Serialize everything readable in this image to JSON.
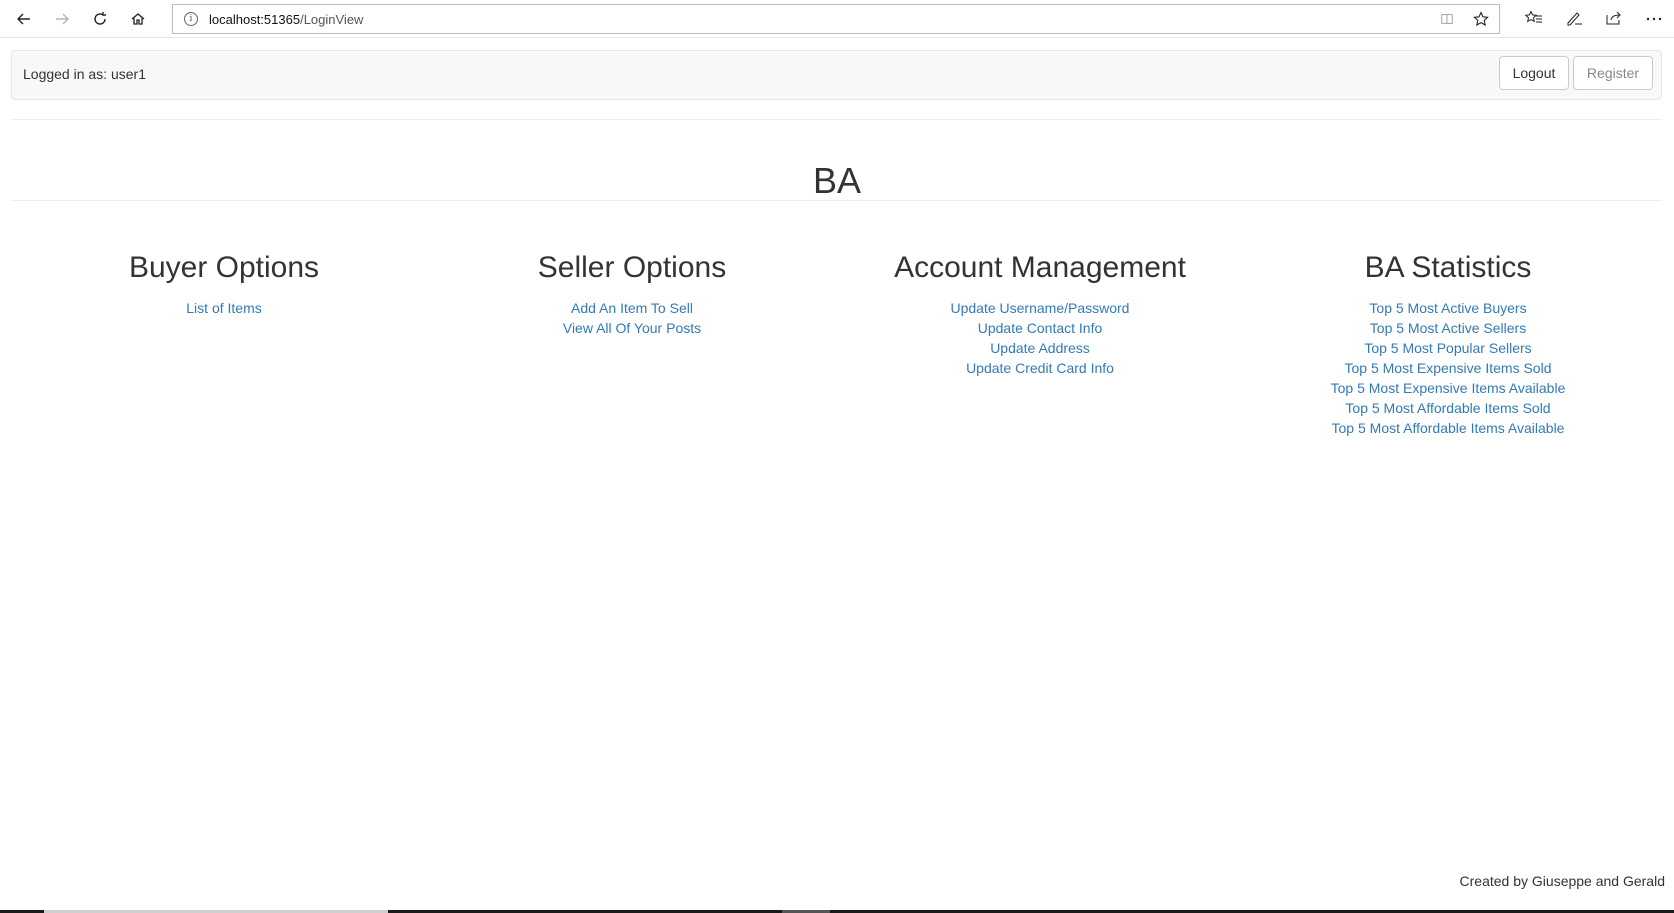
{
  "browser": {
    "url_host": "localhost:51365",
    "url_path": "/LoginView",
    "icons": [
      "back-icon",
      "forward-icon",
      "refresh-icon",
      "home-icon",
      "info-icon",
      "reading-view-icon",
      "favorite-star-icon",
      "favorites-list-icon",
      "pen-icon",
      "share-icon",
      "more-icon"
    ]
  },
  "header": {
    "logged_in_text": "Logged in as: user1",
    "logout_label": "Logout",
    "register_label": "Register"
  },
  "site_title": "BA",
  "columns": [
    {
      "title": "Buyer Options",
      "links": [
        "List of Items"
      ]
    },
    {
      "title": "Seller Options",
      "links": [
        "Add An Item To Sell",
        "View All Of Your Posts"
      ]
    },
    {
      "title": "Account Management",
      "links": [
        "Update Username/Password",
        "Update Contact Info",
        "Update Address",
        "Update Credit Card Info"
      ]
    },
    {
      "title": "BA Statistics",
      "links": [
        "Top 5 Most Active Buyers",
        "Top 5 Most Active Sellers",
        "Top 5 Most Popular Sellers",
        "Top 5 Most Expensive Items Sold",
        "Top 5 Most Expensive Items Available",
        "Top 5 Most Affordable Items Sold",
        "Top 5 Most Affordable Items Available"
      ]
    }
  ],
  "footer": "Created by Giuseppe and Gerald",
  "colors": {
    "link": "#337ab7",
    "text": "#333333",
    "panel_bg": "#f8f8f8"
  }
}
